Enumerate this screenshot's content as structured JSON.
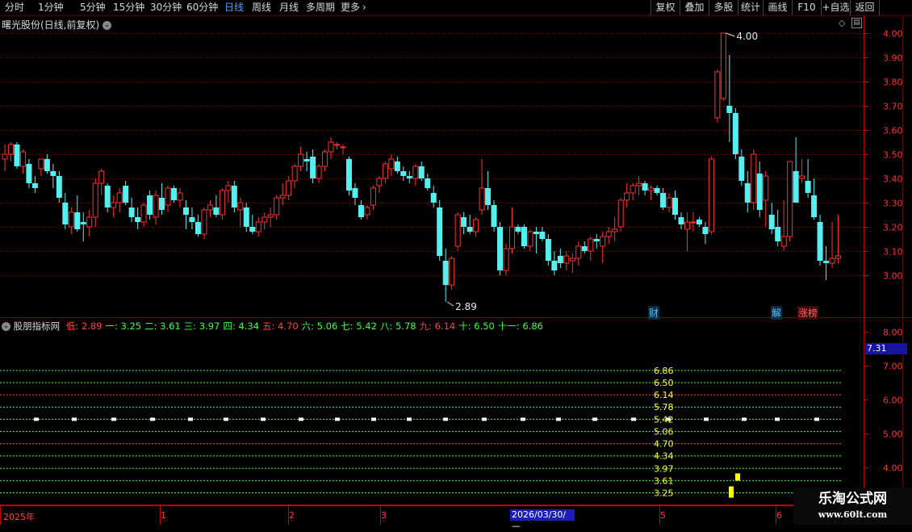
{
  "toolbar": {
    "periods": [
      "分时",
      "1分钟",
      "5分钟",
      "15分钟",
      "30分钟",
      "60分钟",
      "日线",
      "周线",
      "月线",
      "多周期",
      "更多"
    ],
    "active_period": "日线",
    "right_buttons": [
      "复权",
      "叠加",
      "多股",
      "统计",
      "画线",
      "F10",
      "+自选",
      "返回"
    ]
  },
  "main_panel": {
    "title": "曙光股份(日线,前复权)",
    "high_marker": "4.00",
    "low_marker": "2.89",
    "events": [
      {
        "label": "财",
        "color": "#4fc3f7"
      },
      {
        "label": "解",
        "color": "#4fc3f7"
      },
      {
        "label": "涨榜",
        "color": "#ff6060"
      }
    ]
  },
  "indicator_panel": {
    "title": "股朋指标网",
    "levels": [
      {
        "name": "低",
        "value": "2.89",
        "color": "#ff4040"
      },
      {
        "name": "一",
        "value": "3.25",
        "color": "#3cff3c"
      },
      {
        "name": "二",
        "value": "3.61",
        "color": "#3cff3c"
      },
      {
        "name": "三",
        "value": "3.97",
        "color": "#3cff3c"
      },
      {
        "name": "四",
        "value": "4.34",
        "color": "#3cff3c"
      },
      {
        "name": "五",
        "value": "4.70",
        "color": "#ff4040"
      },
      {
        "name": "六",
        "value": "5.06",
        "color": "#3cff3c"
      },
      {
        "name": "七",
        "value": "5.42",
        "color": "#3cff3c"
      },
      {
        "name": "八",
        "value": "5.78",
        "color": "#3cff3c"
      },
      {
        "name": "九",
        "value": "6.14",
        "color": "#ff4040"
      },
      {
        "name": "十",
        "value": "6.50",
        "color": "#3cff3c"
      },
      {
        "name": "十一",
        "value": "6.86",
        "color": "#3cff3c"
      }
    ],
    "current_value": "7.31"
  },
  "time_axis": {
    "labels": [
      "2025年",
      "1",
      "2",
      "3",
      "5",
      "6"
    ],
    "crosshair_date": "2026/03/30/—"
  },
  "watermark": {
    "title": "乐淘公式网",
    "url": "www.60lt.com"
  },
  "chart_data": [
    {
      "type": "candlestick",
      "title": "曙光股份(日线,前复权)",
      "ylim": [
        2.85,
        4.05
      ],
      "yticks": [
        3.0,
        3.1,
        3.2,
        3.3,
        3.4,
        3.5,
        3.6,
        3.7,
        3.8,
        3.9,
        4.0
      ],
      "up_color": "#ff3030",
      "down_color": "#54f0f0",
      "ohlc": [
        [
          3.48,
          3.54,
          3.43,
          3.5
        ],
        [
          3.5,
          3.55,
          3.47,
          3.54
        ],
        [
          3.54,
          3.55,
          3.44,
          3.45
        ],
        [
          3.45,
          3.52,
          3.42,
          3.51
        ],
        [
          3.46,
          3.48,
          3.36,
          3.38
        ],
        [
          3.38,
          3.41,
          3.34,
          3.36
        ],
        [
          3.44,
          3.48,
          3.41,
          3.48
        ],
        [
          3.48,
          3.5,
          3.42,
          3.43
        ],
        [
          3.43,
          3.46,
          3.36,
          3.41
        ],
        [
          3.41,
          3.43,
          3.3,
          3.32
        ],
        [
          3.3,
          3.34,
          3.19,
          3.21
        ],
        [
          3.2,
          3.28,
          3.17,
          3.26
        ],
        [
          3.26,
          3.33,
          3.18,
          3.19
        ],
        [
          3.22,
          3.26,
          3.14,
          3.21
        ],
        [
          3.2,
          3.27,
          3.16,
          3.24
        ],
        [
          3.24,
          3.4,
          3.2,
          3.38
        ],
        [
          3.38,
          3.44,
          3.33,
          3.43
        ],
        [
          3.37,
          3.38,
          3.26,
          3.28
        ],
        [
          3.28,
          3.33,
          3.24,
          3.3
        ],
        [
          3.3,
          3.36,
          3.26,
          3.34
        ],
        [
          3.37,
          3.39,
          3.29,
          3.3
        ],
        [
          3.28,
          3.32,
          3.22,
          3.24
        ],
        [
          3.24,
          3.28,
          3.19,
          3.22
        ],
        [
          3.22,
          3.3,
          3.2,
          3.29
        ],
        [
          3.33,
          3.35,
          3.23,
          3.25
        ],
        [
          3.24,
          3.35,
          3.21,
          3.33
        ],
        [
          3.32,
          3.38,
          3.25,
          3.27
        ],
        [
          3.29,
          3.37,
          3.26,
          3.36
        ],
        [
          3.36,
          3.37,
          3.3,
          3.31
        ],
        [
          3.31,
          3.36,
          3.28,
          3.34
        ],
        [
          3.28,
          3.31,
          3.19,
          3.25
        ],
        [
          3.24,
          3.28,
          3.19,
          3.22
        ],
        [
          3.22,
          3.25,
          3.16,
          3.17
        ],
        [
          3.17,
          3.28,
          3.15,
          3.27
        ],
        [
          3.27,
          3.31,
          3.24,
          3.29
        ],
        [
          3.28,
          3.33,
          3.24,
          3.25
        ],
        [
          3.25,
          3.36,
          3.23,
          3.35
        ],
        [
          3.35,
          3.39,
          3.3,
          3.37
        ],
        [
          3.37,
          3.39,
          3.26,
          3.28
        ],
        [
          3.27,
          3.32,
          3.2,
          3.3
        ],
        [
          3.28,
          3.3,
          3.18,
          3.2
        ],
        [
          3.2,
          3.25,
          3.17,
          3.18
        ],
        [
          3.18,
          3.24,
          3.16,
          3.22
        ],
        [
          3.22,
          3.26,
          3.19,
          3.24
        ],
        [
          3.24,
          3.28,
          3.2,
          3.25
        ],
        [
          3.25,
          3.33,
          3.23,
          3.32
        ],
        [
          3.32,
          3.38,
          3.29,
          3.33
        ],
        [
          3.33,
          3.41,
          3.31,
          3.39
        ],
        [
          3.39,
          3.46,
          3.36,
          3.45
        ],
        [
          3.45,
          3.53,
          3.43,
          3.5
        ],
        [
          3.48,
          3.51,
          3.43,
          3.47
        ],
        [
          3.49,
          3.52,
          3.38,
          3.4
        ],
        [
          3.4,
          3.46,
          3.38,
          3.45
        ],
        [
          3.45,
          3.52,
          3.43,
          3.51
        ],
        [
          3.51,
          3.57,
          3.48,
          3.55
        ],
        [
          3.54,
          3.55,
          3.52,
          3.54
        ],
        [
          3.53,
          3.54,
          3.5,
          3.53
        ],
        [
          3.48,
          3.49,
          3.33,
          3.35
        ],
        [
          3.36,
          3.38,
          3.29,
          3.32
        ],
        [
          3.29,
          3.31,
          3.23,
          3.24
        ],
        [
          3.25,
          3.29,
          3.23,
          3.28
        ],
        [
          3.29,
          3.37,
          3.27,
          3.36
        ],
        [
          3.37,
          3.41,
          3.34,
          3.4
        ],
        [
          3.4,
          3.47,
          3.38,
          3.46
        ],
        [
          3.44,
          3.5,
          3.41,
          3.48
        ],
        [
          3.47,
          3.49,
          3.42,
          3.43
        ],
        [
          3.43,
          3.45,
          3.39,
          3.41
        ],
        [
          3.41,
          3.43,
          3.38,
          3.4
        ],
        [
          3.4,
          3.46,
          3.37,
          3.45
        ],
        [
          3.45,
          3.47,
          3.39,
          3.4
        ],
        [
          3.4,
          3.42,
          3.35,
          3.36
        ],
        [
          3.34,
          3.37,
          3.28,
          3.3
        ],
        [
          3.28,
          3.31,
          3.06,
          3.08
        ],
        [
          3.06,
          3.11,
          2.89,
          2.96
        ],
        [
          2.96,
          3.08,
          2.94,
          3.07
        ],
        [
          3.12,
          3.26,
          3.1,
          3.25
        ],
        [
          3.24,
          3.26,
          3.17,
          3.2
        ],
        [
          3.2,
          3.25,
          3.17,
          3.18
        ],
        [
          3.18,
          3.24,
          3.16,
          3.23
        ],
        [
          3.27,
          3.48,
          3.25,
          3.36
        ],
        [
          3.36,
          3.43,
          3.27,
          3.29
        ],
        [
          3.29,
          3.31,
          3.18,
          3.2
        ],
        [
          3.2,
          3.22,
          3.0,
          3.02
        ],
        [
          3.02,
          3.13,
          3.0,
          3.11
        ],
        [
          3.11,
          3.28,
          3.09,
          3.2
        ],
        [
          3.2,
          3.21,
          3.17,
          3.18
        ],
        [
          3.2,
          3.21,
          3.11,
          3.12
        ],
        [
          3.12,
          3.19,
          3.1,
          3.18
        ],
        [
          3.18,
          3.2,
          3.09,
          3.17
        ],
        [
          3.18,
          3.2,
          3.14,
          3.15
        ],
        [
          3.15,
          3.17,
          3.04,
          3.06
        ],
        [
          3.06,
          3.1,
          3.0,
          3.02
        ],
        [
          3.08,
          3.11,
          3.03,
          3.05
        ],
        [
          3.05,
          3.1,
          3.02,
          3.08
        ],
        [
          3.06,
          3.09,
          3.01,
          3.07
        ],
        [
          3.07,
          3.14,
          3.04,
          3.12
        ],
        [
          3.12,
          3.14,
          3.09,
          3.1
        ],
        [
          3.1,
          3.16,
          3.06,
          3.15
        ],
        [
          3.15,
          3.17,
          3.11,
          3.14
        ],
        [
          3.12,
          3.18,
          3.05,
          3.16
        ],
        [
          3.16,
          3.2,
          3.13,
          3.18
        ],
        [
          3.18,
          3.24,
          3.14,
          3.19
        ],
        [
          3.2,
          3.32,
          3.18,
          3.31
        ],
        [
          3.31,
          3.38,
          3.28,
          3.34
        ],
        [
          3.34,
          3.38,
          3.31,
          3.37
        ],
        [
          3.37,
          3.41,
          3.33,
          3.38
        ],
        [
          3.38,
          3.39,
          3.33,
          3.35
        ],
        [
          3.35,
          3.37,
          3.31,
          3.36
        ],
        [
          3.36,
          3.37,
          3.33,
          3.34
        ],
        [
          3.34,
          3.36,
          3.27,
          3.28
        ],
        [
          3.28,
          3.34,
          3.26,
          3.32
        ],
        [
          3.32,
          3.35,
          3.23,
          3.25
        ],
        [
          3.24,
          3.26,
          3.19,
          3.21
        ],
        [
          3.19,
          3.26,
          3.1,
          3.22
        ],
        [
          3.22,
          3.26,
          3.18,
          3.22
        ],
        [
          3.23,
          3.24,
          3.2,
          3.21
        ],
        [
          3.2,
          3.22,
          3.13,
          3.17
        ],
        [
          3.18,
          3.49,
          3.17,
          3.48
        ],
        [
          3.65,
          3.85,
          3.63,
          3.84
        ],
        [
          3.73,
          4.0,
          3.72,
          4.0
        ],
        [
          3.7,
          3.91,
          3.55,
          3.67
        ],
        [
          3.67,
          3.69,
          3.48,
          3.5
        ],
        [
          3.49,
          3.52,
          3.37,
          3.39
        ],
        [
          3.38,
          3.43,
          3.26,
          3.3
        ],
        [
          3.3,
          3.52,
          3.27,
          3.5
        ],
        [
          3.42,
          3.47,
          3.24,
          3.27
        ],
        [
          3.31,
          3.43,
          3.2,
          3.41
        ],
        [
          3.25,
          3.3,
          3.17,
          3.19
        ],
        [
          3.2,
          3.27,
          3.12,
          3.14
        ],
        [
          3.12,
          3.31,
          3.1,
          3.16
        ],
        [
          3.16,
          3.47,
          3.14,
          3.47
        ],
        [
          3.43,
          3.57,
          3.4,
          3.3
        ],
        [
          3.4,
          3.48,
          3.38,
          3.41
        ],
        [
          3.39,
          3.48,
          3.32,
          3.34
        ],
        [
          3.33,
          3.4,
          3.23,
          3.24
        ],
        [
          3.22,
          3.25,
          3.04,
          3.06
        ],
        [
          3.06,
          3.12,
          2.98,
          3.05
        ],
        [
          3.05,
          3.22,
          3.03,
          3.07
        ],
        [
          3.07,
          3.25,
          3.05,
          3.08
        ]
      ]
    },
    {
      "type": "line",
      "title": "股朋指标网",
      "ylim": [
        3.45,
        8.3
      ],
      "yticks": [
        4.0,
        5.0,
        6.0,
        7.0,
        8.0
      ],
      "levels": [
        2.89,
        3.25,
        3.61,
        3.97,
        4.34,
        4.7,
        5.06,
        5.42,
        5.78,
        6.14,
        6.5,
        6.86
      ],
      "level_colors": [
        "#ff4040",
        "#3cff3c",
        "#3cff3c",
        "#3cff3c",
        "#3cff3c",
        "#ff4040",
        "#3cff3c",
        "#3cff3c",
        "#3cff3c",
        "#ff4040",
        "#3cff3c",
        "#3cff3c"
      ],
      "level_labels": [
        "3.25",
        "3.61",
        "3.97",
        "4.34",
        "4.70",
        "5.06",
        "5.42",
        "5.78",
        "6.14",
        "6.50",
        "6.86"
      ],
      "markers": [
        {
          "value": 3.25,
          "color": "#ffff00"
        },
        {
          "value": 3.61,
          "color": "#ffff00"
        }
      ]
    }
  ]
}
